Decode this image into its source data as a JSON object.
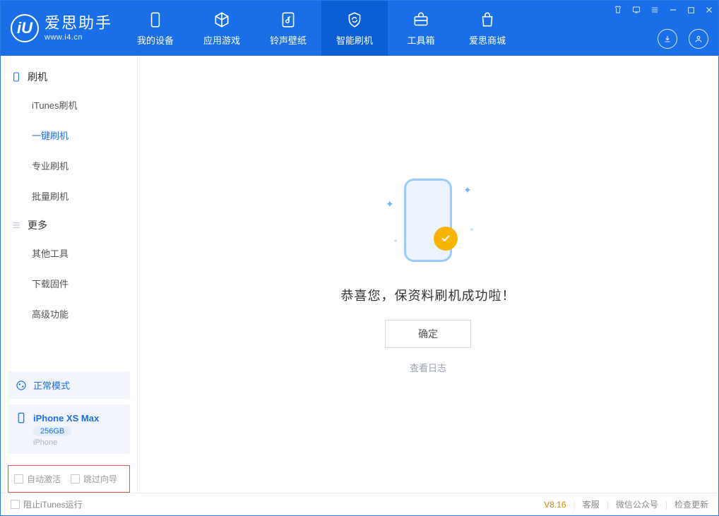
{
  "app": {
    "title": "爱思助手",
    "subtitle": "www.i4.cn",
    "logo_letter": "iU"
  },
  "header_tabs": [
    {
      "label": "我的设备"
    },
    {
      "label": "应用游戏"
    },
    {
      "label": "铃声壁纸"
    },
    {
      "label": "智能刷机"
    },
    {
      "label": "工具箱"
    },
    {
      "label": "爱思商城"
    }
  ],
  "sidebar": {
    "group1": {
      "title": "刷机",
      "items": [
        "iTunes刷机",
        "一键刷机",
        "专业刷机",
        "批量刷机"
      ],
      "active_index": 1
    },
    "group2": {
      "title": "更多",
      "items": [
        "其他工具",
        "下载固件",
        "高级功能"
      ]
    },
    "mode": {
      "label": "正常模式"
    },
    "device": {
      "name": "iPhone XS Max",
      "capacity": "256GB",
      "type": "iPhone"
    },
    "checkboxes": {
      "auto_activate": "自动激活",
      "skip_guide": "跳过向导"
    }
  },
  "main": {
    "success_text": "恭喜您，保资料刷机成功啦！",
    "ok_button": "确定",
    "view_log": "查看日志"
  },
  "statusbar": {
    "block_itunes": "阻止iTunes运行",
    "version": "V8.16",
    "links": [
      "客服",
      "微信公众号",
      "检查更新"
    ]
  }
}
